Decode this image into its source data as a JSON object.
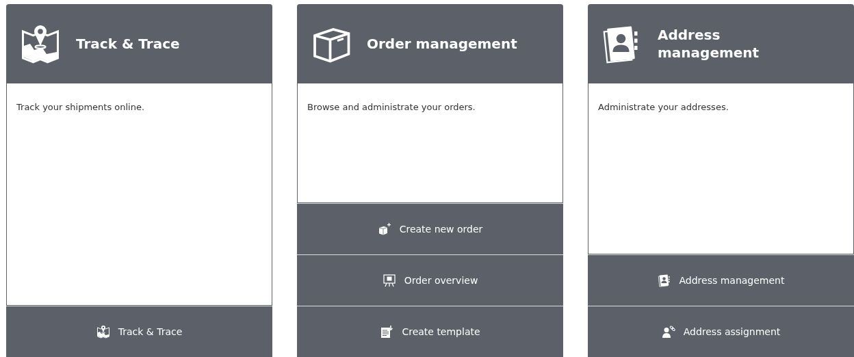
{
  "cards": [
    {
      "title": "Track & Trace",
      "kind": "map",
      "description": "Track your shipments online.",
      "actions": [
        {
          "label": "Track & Trace",
          "kind": "map"
        }
      ]
    },
    {
      "title": "Order management",
      "kind": "box",
      "description": "Browse and administrate your orders.",
      "actions": [
        {
          "label": "Create new order",
          "kind": "box-plus"
        },
        {
          "label": "Order overview",
          "kind": "presentation"
        },
        {
          "label": "Create template",
          "kind": "template"
        }
      ]
    },
    {
      "title": "Address management",
      "kind": "addressbook",
      "description": "Administrate your addresses.",
      "actions": [
        {
          "label": "Address management",
          "kind": "addressbook"
        },
        {
          "label": "Address assignment",
          "kind": "person-link"
        }
      ]
    }
  ]
}
